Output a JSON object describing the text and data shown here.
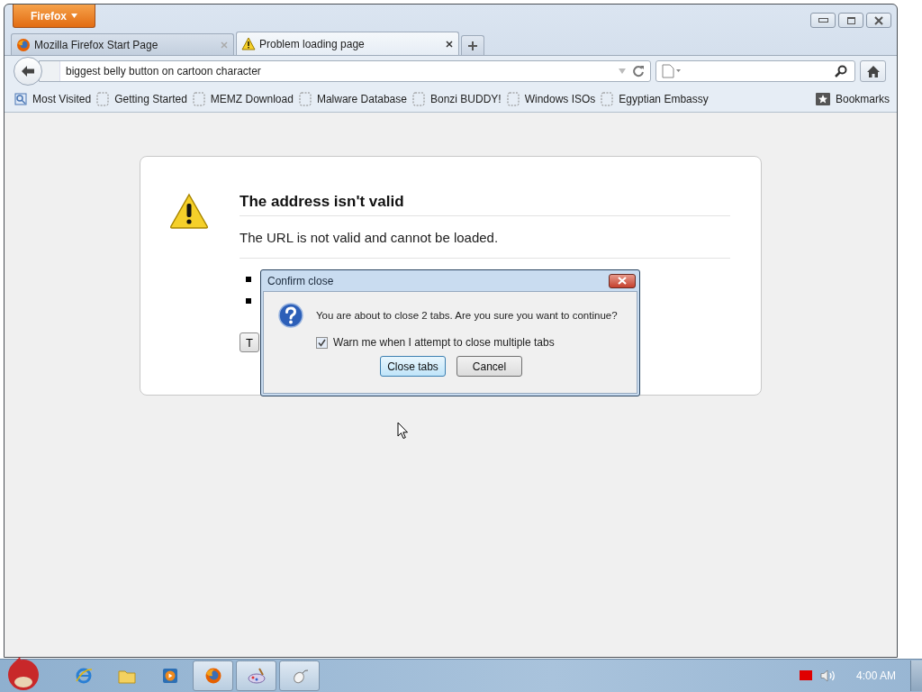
{
  "firefox_menu": {
    "label": "Firefox"
  },
  "tabs": [
    {
      "label": "Mozilla Firefox Start Page",
      "selected": false,
      "kind": "firefox"
    },
    {
      "label": "Problem loading page",
      "selected": true,
      "kind": "warning"
    }
  ],
  "address_bar": {
    "value": "biggest belly button on cartoon character"
  },
  "bookmarks_toolbar": {
    "items": [
      {
        "label": "Most Visited",
        "kind": "smart"
      },
      {
        "label": "Getting Started",
        "kind": "page"
      },
      {
        "label": "MEMZ Download",
        "kind": "page"
      },
      {
        "label": "Malware Database",
        "kind": "page"
      },
      {
        "label": "Bonzi BUDDY!",
        "kind": "page"
      },
      {
        "label": "Windows ISOs",
        "kind": "page"
      },
      {
        "label": "Egyptian Embassy",
        "kind": "page"
      }
    ],
    "bookmarks_menu": "Bookmarks"
  },
  "error_page": {
    "title": "The address isn't valid",
    "description": "The URL is not valid and cannot be loaded.",
    "try_button": "T"
  },
  "dialog": {
    "title": "Confirm close",
    "message": "You are about to close 2 tabs. Are you sure you want to continue?",
    "checkbox": {
      "label": "Warn me when I attempt to close multiple tabs",
      "checked": true
    },
    "buttons": [
      {
        "label": "Close tabs",
        "default": true
      },
      {
        "label": "Cancel",
        "default": false
      }
    ]
  },
  "taskbar": {
    "apps": [
      {
        "kind": "ie",
        "active": false
      },
      {
        "kind": "folder",
        "active": false
      },
      {
        "kind": "media",
        "active": false
      },
      {
        "kind": "firefox",
        "active": true
      },
      {
        "kind": "paint",
        "active": true
      },
      {
        "kind": "mouse",
        "active": true
      }
    ],
    "clock": "4:00 AM"
  }
}
